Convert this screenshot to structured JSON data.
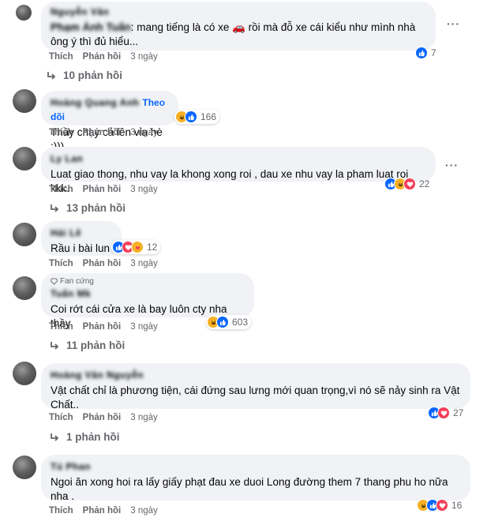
{
  "comments": [
    {
      "author": "Nguyễn Văn",
      "mention": "Phạm Ánh Tuấn",
      "text": ": mang tiếng là có xe 🚗 rồi mà đỗ xe cái kiểu như mình nhà ông ý thì đủ hiểu...",
      "like": "Thích",
      "reply": "Phản hồi",
      "time": "3 ngày",
      "reaction_count": "7",
      "replies": "10 phản hồi"
    },
    {
      "author": "Hoàng Quang Anh",
      "follow": "Theo dõi",
      "text": "Thầy chạy cả lên vỉa hè :)))",
      "like": "Thích",
      "reply": "Phản hồi",
      "time": "3 ngày",
      "reaction_count": "166"
    },
    {
      "author": "Ly Lan",
      "text": "Luat giao thong, nhu vay la khong xong roi , dau xe nhu vay la pham luat roi kkk.",
      "like": "Thích",
      "reply": "Phản hồi",
      "time": "3 ngày",
      "reaction_count": "22",
      "replies": "13 phản hồi"
    },
    {
      "author": "Hải Lê",
      "text": "Rầu i bài lun",
      "like": "Thích",
      "reply": "Phản hồi",
      "time": "3 ngày",
      "reaction_count": "12"
    },
    {
      "badge": "Fan cứng",
      "author": "Tuấn Mk",
      "text": "Coi rớt cái cửa xe là bay luôn cty nha thầy",
      "like": "Thích",
      "reply": "Phản hồi",
      "time": "3 ngày",
      "reaction_count": "603",
      "replies": "11 phản hồi"
    },
    {
      "author": "Hoàng Văn Nguyễn",
      "text": "Vật chất chỉ là phương tiện, cái đứng sau lưng mới quan trọng,vì nó sẽ nảy sinh ra Vật Chất..",
      "like": "Thích",
      "reply": "Phản hồi",
      "time": "3 ngày",
      "reaction_count": "27",
      "replies": "1 phản hồi"
    },
    {
      "author": "Tú Phan",
      "text": "Ngoi ăn xong hoi ra lấy giấy phạt đau xe duoi Long đường them 7 thang phu ho nữa nha .",
      "like": "Thích",
      "reply": "Phản hồi",
      "time": "3 ngày",
      "reaction_count": "16"
    }
  ],
  "more_icon": "more-horizontal-icon",
  "colors": {
    "like": "#0866ff",
    "love": "#f33e58",
    "haha": "#f7b125",
    "follow": "#0866ff"
  }
}
